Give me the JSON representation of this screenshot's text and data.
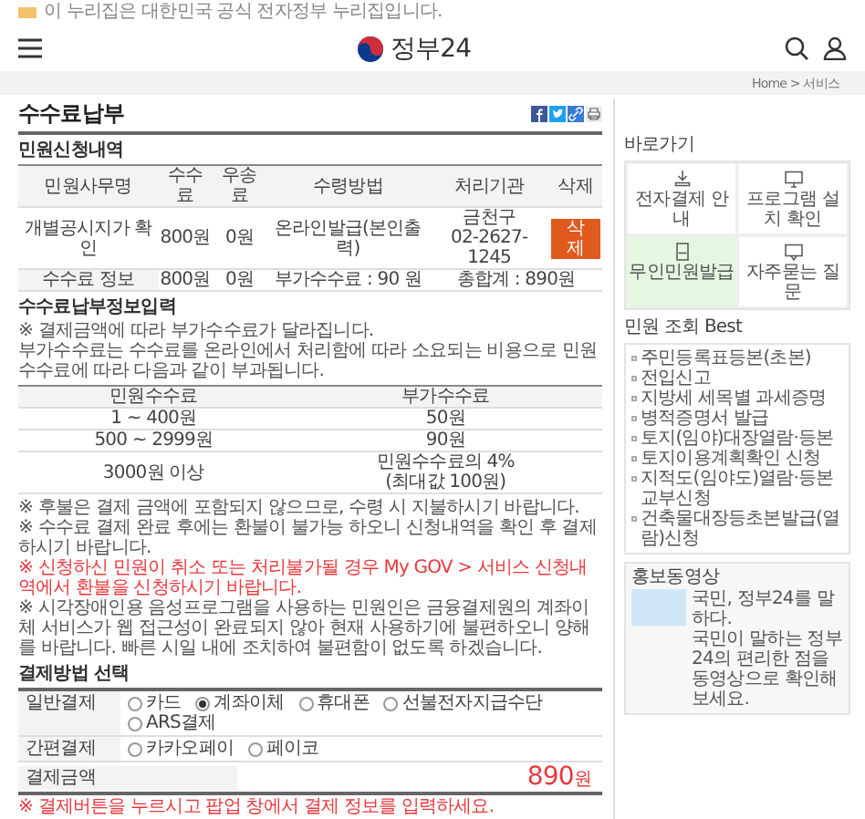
{
  "notice": "이 누리집은 대한민국 공식 전자정부 누리집입니다.",
  "header": {
    "logo": "정부24"
  },
  "breadcrumb": "Home > 서비스",
  "page_title": "수수료납부",
  "application": {
    "title": "민원신청내역",
    "columns": [
      "민원사무명",
      "수수료",
      "우송료",
      "수령방법",
      "처리기관",
      "삭제"
    ],
    "rows": [
      {
        "cells": [
          "개별공시지가 확인",
          "800원",
          "0원",
          "온라인발급(본인출력)",
          "금천구\n02-2627-1245"
        ],
        "delete_button": "삭제"
      }
    ],
    "summary": {
      "label": "수수료 정보",
      "fee": "800원",
      "postage": "0원",
      "extra": "부가수수료 : 90 원",
      "total": "총합계 : 890원"
    }
  },
  "fee_info": {
    "title": "수수료납부정보입력",
    "notes": [
      "※ 결제금액에 따라 부가수수료가 달라집니다.",
      "부가수수료는 수수료를 온라인에서 처리함에 따라 소요되는 비용으로 민원수수료에 따라 다음과 같이 부과됩니다."
    ],
    "columns": [
      "민원수수료",
      "부가수수료"
    ],
    "rows": [
      [
        "1 ~ 400원",
        "50원"
      ],
      [
        "500 ~ 2999원",
        "90원"
      ],
      [
        "3000원 이상",
        "민원수수료의 4%\n(최대값 100원)"
      ]
    ]
  },
  "notices": [
    {
      "text": "※ 후불은 결제 금액에 포함되지 않으므로, 수령 시 지불하시기 바랍니다.",
      "emphasis": false
    },
    {
      "text": "※ 수수료 결제 완료 후에는 환불이 불가능 하오니 신청내역을 확인 후 결제하시기 바랍니다.",
      "emphasis": false
    },
    {
      "text": "※ 신청하신 민원이 취소 또는 처리불가될 경우 My GOV > 서비스 신청내역에서 환불을 신청하시기 바랍니다.",
      "emphasis": true
    },
    {
      "text": "※ 시각장애인용 음성프로그램을 사용하는 민원인은 금융결제원의 계좌이체 서비스가 웹 접근성이 완료되지 않아 현재 사용하기에 불편하오니 양해를 바랍니다. 빠른 시일 내에 조치하여 불편함이 없도록 하겠습니다.",
      "emphasis": false
    }
  ],
  "payment": {
    "title": "결제방법 선택",
    "groups": [
      {
        "label": "일반결제",
        "options": [
          {
            "label": "카드",
            "selected": false
          },
          {
            "label": "계좌이체",
            "selected": true
          },
          {
            "label": "휴대폰",
            "selected": false
          },
          {
            "label": "선불전자지급수단",
            "selected": false
          },
          {
            "label": "ARS결제",
            "selected": false
          }
        ]
      },
      {
        "label": "간편결제",
        "options": [
          {
            "label": "카카오페이",
            "selected": false
          },
          {
            "label": "페이코",
            "selected": false
          }
        ]
      }
    ],
    "amount": {
      "label": "결제금액",
      "value": "890",
      "unit": "원"
    },
    "note": "※ 결제버튼을 누르시고 팝업 창에서 결제 정보를 입력하세요."
  },
  "sidebar": {
    "shortcuts": {
      "title": "바로가기",
      "items": [
        {
          "label": "전자결제 안내",
          "kind": "download",
          "selected": false
        },
        {
          "label": "프로그램 설치 확인",
          "kind": "monitor",
          "selected": false
        },
        {
          "label": "무인민원발급",
          "kind": "kiosk",
          "selected": true
        },
        {
          "label": "자주묻는 질문",
          "kind": "chat",
          "selected": false
        }
      ]
    },
    "best": {
      "title": "민원 조회 Best",
      "items": [
        "주민등록표등본(초본)",
        "전입신고",
        "지방세 세목별 과세증명",
        "병적증명서 발급",
        "토지(임야)대장열람·등본",
        "토지이용계획확인 신청",
        "지적도(임야도)열람·등본교부신청",
        "건축물대장등초본발급(열람)신청"
      ]
    },
    "video": {
      "title": "홍보동영상",
      "headline": "국민, 정부24를 말하다.",
      "description": "국민이 말하는 정부24의 편리한 점을 동영상으로 확인해 보세요."
    }
  }
}
